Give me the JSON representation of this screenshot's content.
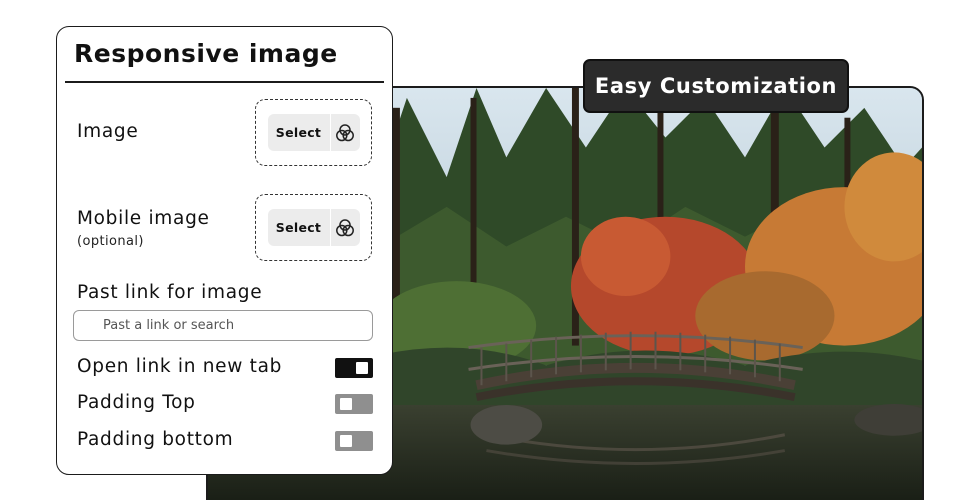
{
  "badge": {
    "label": "Easy Customization"
  },
  "panel": {
    "title": "Responsive image",
    "image": {
      "label": "Image",
      "select_label": "Select",
      "icon": "color-circles-icon"
    },
    "mobile_image": {
      "label": "Mobile image",
      "sublabel": "(optional)",
      "select_label": "Select",
      "icon": "color-circles-icon"
    },
    "link": {
      "label": "Past link for image",
      "placeholder": "Past a link or search"
    },
    "toggles": [
      {
        "label": "Open link in new tab",
        "state": "on"
      },
      {
        "label": "Padding Top",
        "state": "off"
      },
      {
        "label": "Padding bottom",
        "state": "off"
      }
    ]
  },
  "colors": {
    "dark": "#1b1b1b",
    "toggle_on": "#111111",
    "toggle_off": "#8f8f8f",
    "button_bg": "#ececec"
  },
  "photo": {
    "subject": "park-bridge-photo"
  }
}
